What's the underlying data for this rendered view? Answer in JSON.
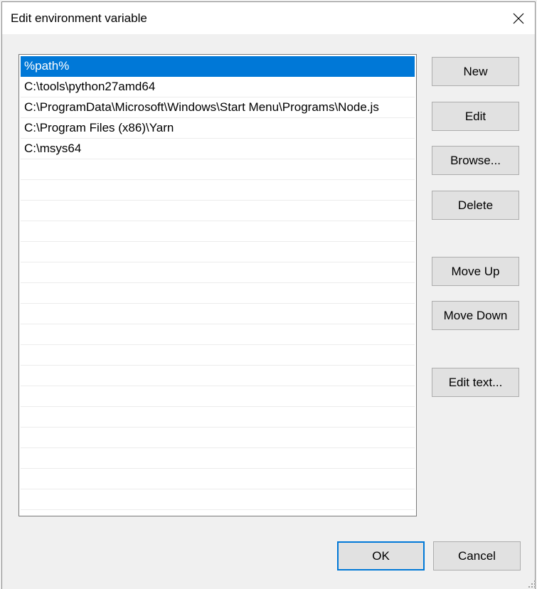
{
  "window": {
    "title": "Edit environment variable",
    "close_icon": "close-icon"
  },
  "list": {
    "items": [
      {
        "value": "%path%",
        "selected": true
      },
      {
        "value": "C:\\tools\\python27amd64",
        "selected": false
      },
      {
        "value": "C:\\ProgramData\\Microsoft\\Windows\\Start Menu\\Programs\\Node.js",
        "selected": false
      },
      {
        "value": "C:\\Program Files (x86)\\Yarn",
        "selected": false
      },
      {
        "value": "C:\\msys64",
        "selected": false
      }
    ],
    "empty_rows": 17,
    "selection_color": "#0078d7"
  },
  "buttons": {
    "new": "New",
    "edit": "Edit",
    "browse": "Browse...",
    "delete": "Delete",
    "move_up": "Move Up",
    "move_down": "Move Down",
    "edit_text": "Edit text...",
    "ok": "OK",
    "cancel": "Cancel"
  },
  "accent_color": "#0078d7"
}
